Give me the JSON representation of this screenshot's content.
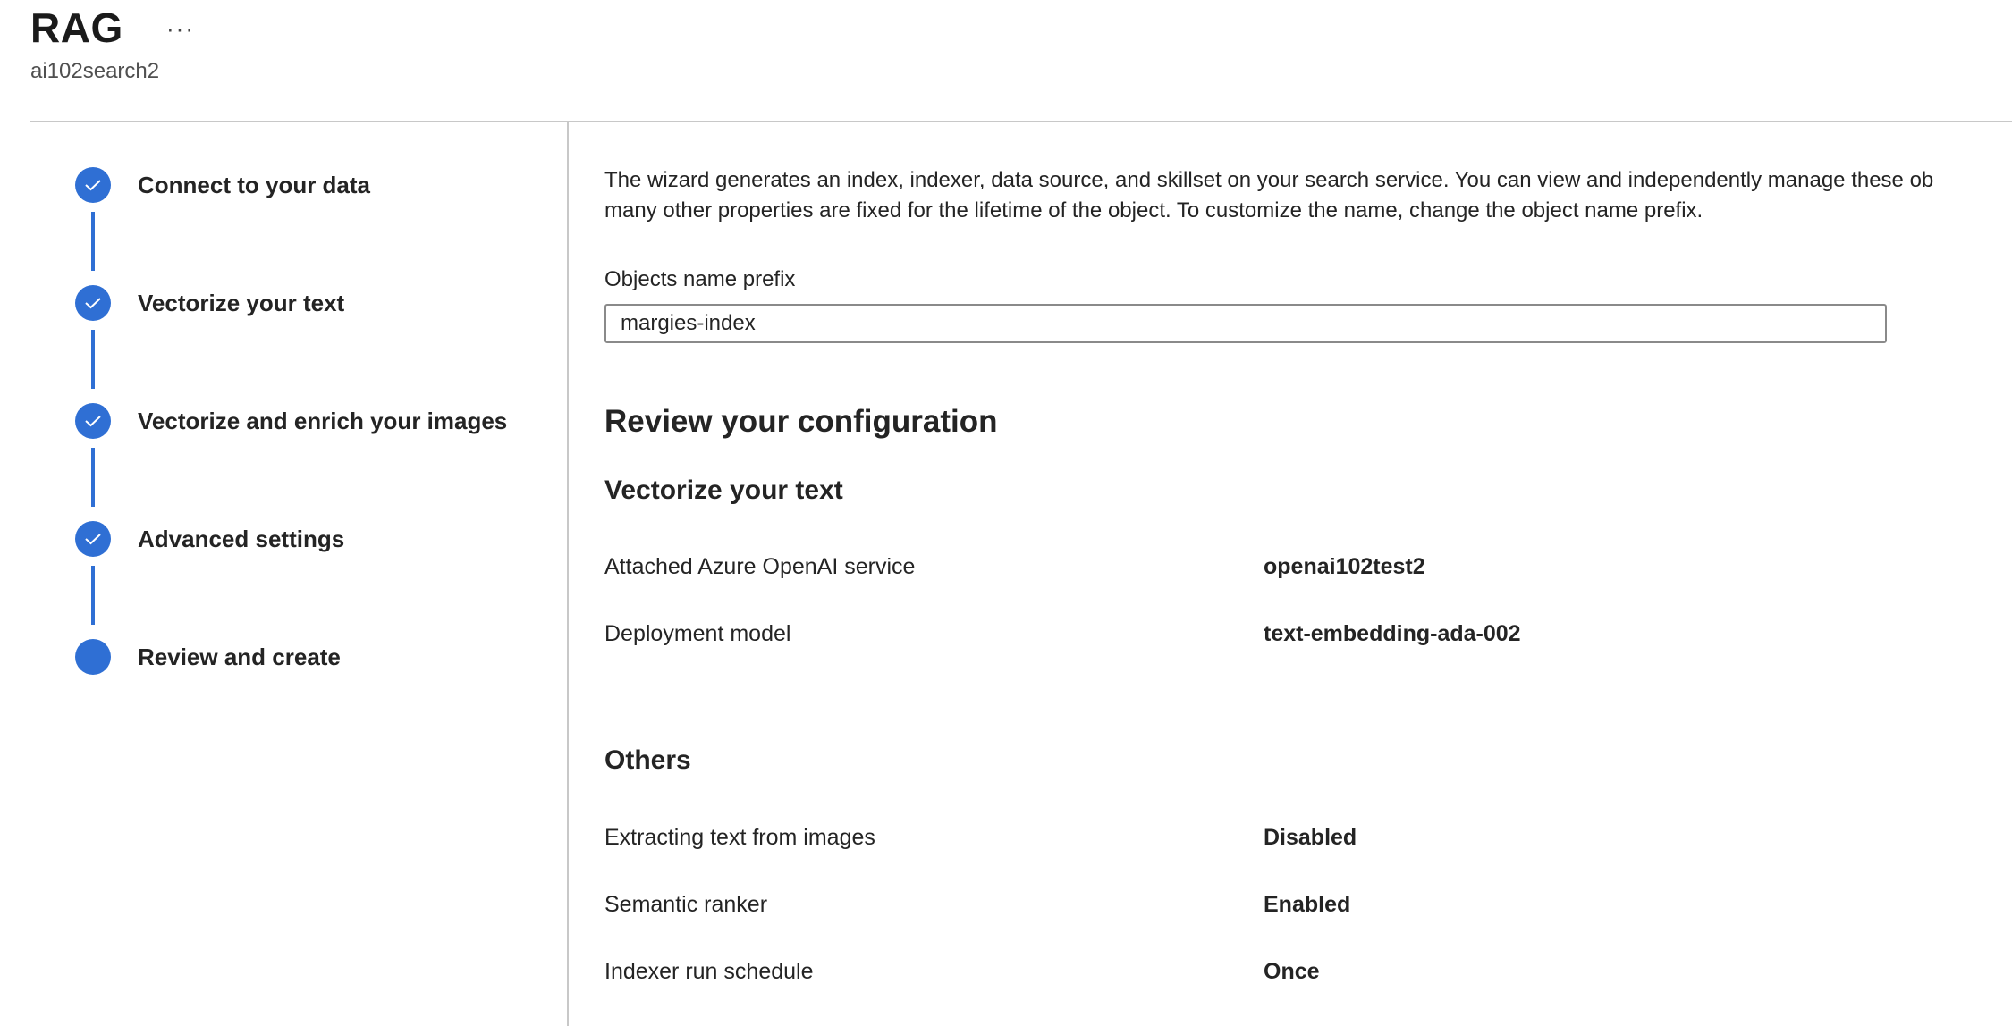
{
  "header": {
    "title": "RAG",
    "more_label": "···",
    "subtitle": "ai102search2"
  },
  "stepper": {
    "steps": [
      {
        "label": "Connect to your data",
        "state": "completed"
      },
      {
        "label": "Vectorize your text",
        "state": "completed"
      },
      {
        "label": "Vectorize and enrich your images",
        "state": "completed"
      },
      {
        "label": "Advanced settings",
        "state": "completed"
      },
      {
        "label": "Review and create",
        "state": "current"
      }
    ],
    "accent_color": "#2f6fd4"
  },
  "main": {
    "intro_line1": "The wizard generates an index, indexer, data source, and skillset on your search service. You can view and independently manage these ob",
    "intro_line2": "many other properties are fixed for the lifetime of the object. To customize the name, change the object name prefix.",
    "prefix_label": "Objects name prefix",
    "prefix_value": "margies-index",
    "review_heading": "Review your configuration",
    "vectorize_section": {
      "heading": "Vectorize your text",
      "rows": [
        {
          "key": "Attached Azure OpenAI service",
          "value": "openai102test2"
        },
        {
          "key": "Deployment model",
          "value": "text-embedding-ada-002"
        }
      ]
    },
    "others_section": {
      "heading": "Others",
      "rows": [
        {
          "key": "Extracting text from images",
          "value": "Disabled"
        },
        {
          "key": "Semantic ranker",
          "value": "Enabled"
        },
        {
          "key": "Indexer run schedule",
          "value": "Once"
        }
      ]
    }
  }
}
